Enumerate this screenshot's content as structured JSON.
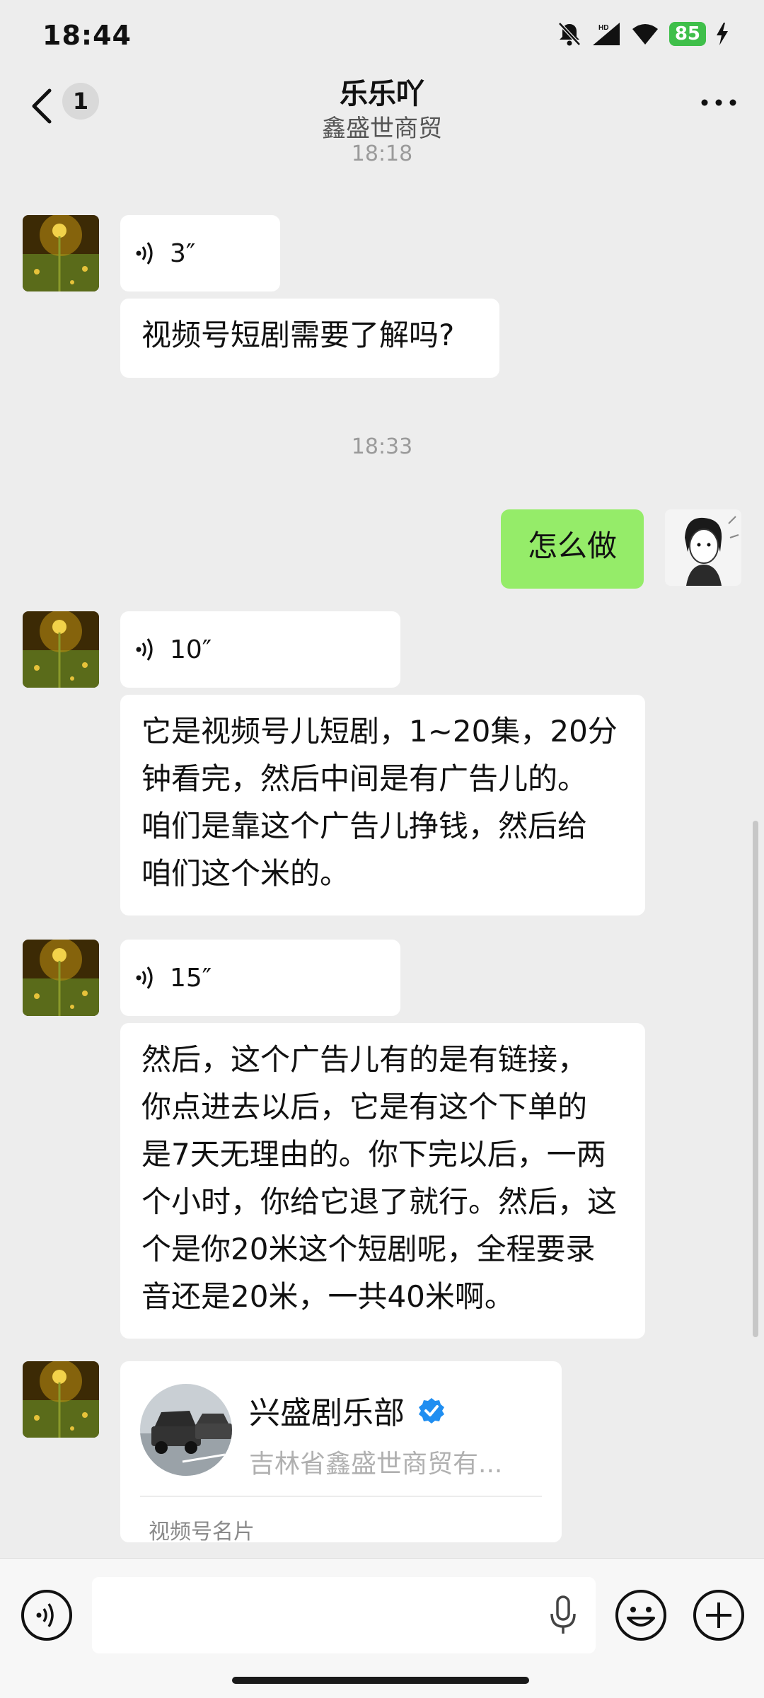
{
  "status_bar": {
    "time": "18:44",
    "battery": "85",
    "network": "HD"
  },
  "header": {
    "title": "乐乐吖",
    "subtitle": "鑫盛世商贸",
    "unread_count": "1"
  },
  "timestamps": {
    "top": "18:18",
    "middle": "18:33"
  },
  "messages": {
    "voice1_duration": "3″",
    "text1": "视频号短剧需要了解吗?",
    "me_text": "怎么做",
    "voice2_duration": "10″",
    "text2_l1": "它是视频号儿短剧，1~20集，20分",
    "text2_l2": "钟看完，然后中间是有广告儿的。",
    "text2_l3": "咱们是靠这个广告儿挣钱，然后给",
    "text2_l4": "咱们这个米的。",
    "voice3_duration": "15″",
    "text3_l1": "然后，这个广告儿有的是有链接，",
    "text3_l2": "你点进去以后，它是有这个下单的",
    "text3_l3": "是7天无理由的。你下完以后，一两",
    "text3_l4": "个小时，你给它退了就行。然后，这",
    "text3_l5": "个是你20米这个短剧呢，全程要录",
    "text3_l6": "音还是20米，一共40米啊。"
  },
  "card": {
    "name": "兴盛剧乐部",
    "description": "吉林省鑫盛世商贸有...",
    "type_label": "视频号名片"
  },
  "colors": {
    "me_bubble": "#95ec69",
    "background": "#ededed",
    "verified": "#1f8ef1"
  }
}
